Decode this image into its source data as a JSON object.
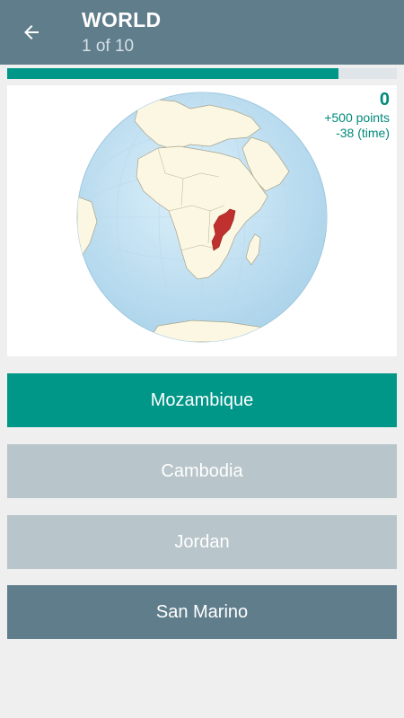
{
  "header": {
    "title": "WORLD",
    "subtitle": "1 of 10",
    "back_icon": "arrow-left-icon"
  },
  "progress": {
    "fraction": 0.85
  },
  "score": {
    "value": "0",
    "points_line": "+500 points",
    "time_line": "-38 (time)"
  },
  "map": {
    "highlight_color": "#c0302e",
    "ocean_color": "#cde6f3",
    "land_color": "#fbf7e3"
  },
  "answers": [
    {
      "label": "Mozambique"
    },
    {
      "label": "Cambodia"
    },
    {
      "label": "Jordan"
    },
    {
      "label": "San Marino"
    }
  ],
  "colors": {
    "appbar": "#607d8b",
    "accent": "#009688",
    "disabled_option": "#b8c5ca"
  }
}
